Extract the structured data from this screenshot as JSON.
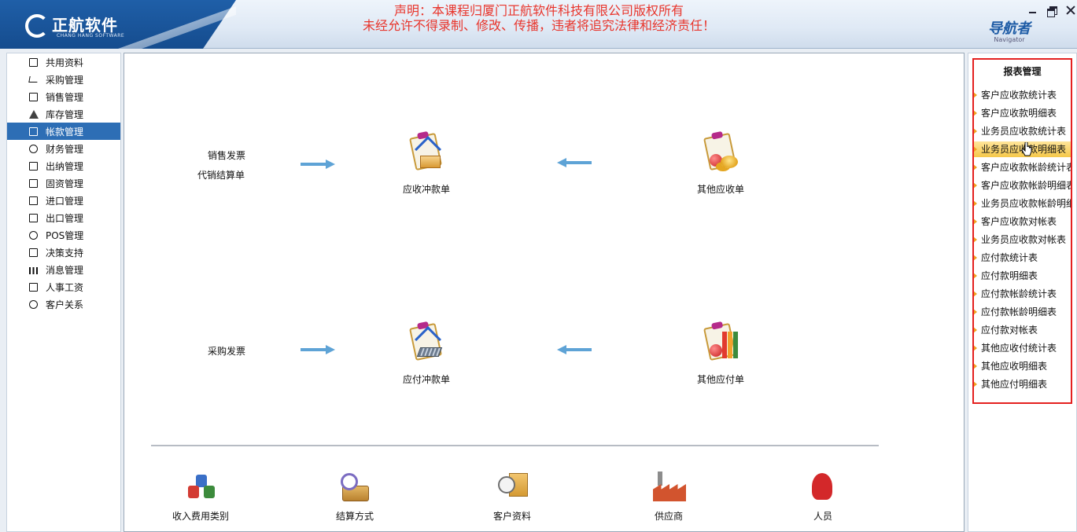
{
  "header": {
    "logo_text": "正航软件",
    "logo_sub": "CHANG HANG SOFTWARE",
    "notice_line1": "声明：本课程归厦门正航软件科技有限公司版权所有",
    "notice_line2": "未经允许不得录制、修改、传播，违者将追究法律和经济责任！",
    "navigator_title": "导航者",
    "navigator_sub": "Navigator"
  },
  "sidebar": {
    "items": [
      {
        "label": "共用资料",
        "icon": "document-icon"
      },
      {
        "label": "采购管理",
        "icon": "cart-icon"
      },
      {
        "label": "销售管理",
        "icon": "sales-icon"
      },
      {
        "label": "库存管理",
        "icon": "warehouse-icon"
      },
      {
        "label": "帐款管理",
        "icon": "ledger-icon",
        "active": true
      },
      {
        "label": "财务管理",
        "icon": "finance-icon"
      },
      {
        "label": "出纳管理",
        "icon": "cashier-icon"
      },
      {
        "label": "固资管理",
        "icon": "asset-icon"
      },
      {
        "label": "进口管理",
        "icon": "import-icon"
      },
      {
        "label": "出口管理",
        "icon": "export-icon"
      },
      {
        "label": "POS管理",
        "icon": "pos-icon"
      },
      {
        "label": "决策支持",
        "icon": "decision-icon"
      },
      {
        "label": "消息管理",
        "icon": "message-icon"
      },
      {
        "label": "人事工资",
        "icon": "hr-icon"
      },
      {
        "label": "客户关系",
        "icon": "customer-icon"
      }
    ]
  },
  "main": {
    "flow_top": {
      "label1": "销售发票",
      "label2": "代销结算单",
      "center_tile": "应收冲款单",
      "right_tile": "其他应收单"
    },
    "flow_bottom": {
      "label1": "采购发票",
      "center_tile": "应付冲款单",
      "right_tile": "其他应付单"
    },
    "bottom_tiles": [
      {
        "label": "收入费用类别"
      },
      {
        "label": "结算方式"
      },
      {
        "label": "客户资料"
      },
      {
        "label": "供应商"
      },
      {
        "label": "人员"
      }
    ]
  },
  "report_panel": {
    "title": "报表管理",
    "items": [
      "客户应收款统计表",
      "客户应收款明细表",
      "业务员应收款统计表",
      "业务员应收款明细表",
      "客户应收款帐龄统计表",
      "客户应收款帐龄明细表",
      "业务员应收款帐龄明细",
      "客户应收款对帐表",
      "业务员应收款对帐表",
      "应付款统计表",
      "应付款明细表",
      "应付款帐龄统计表",
      "应付款帐龄明细表",
      "应付款对帐表",
      "其他应收付统计表",
      "其他应收明细表",
      "其他应付明细表"
    ],
    "hover_index": 3
  },
  "colors": {
    "active": "#2d6eb5",
    "notice": "#e8352c",
    "report_border": "#e4201f",
    "arrow": "#5ea3d6"
  }
}
